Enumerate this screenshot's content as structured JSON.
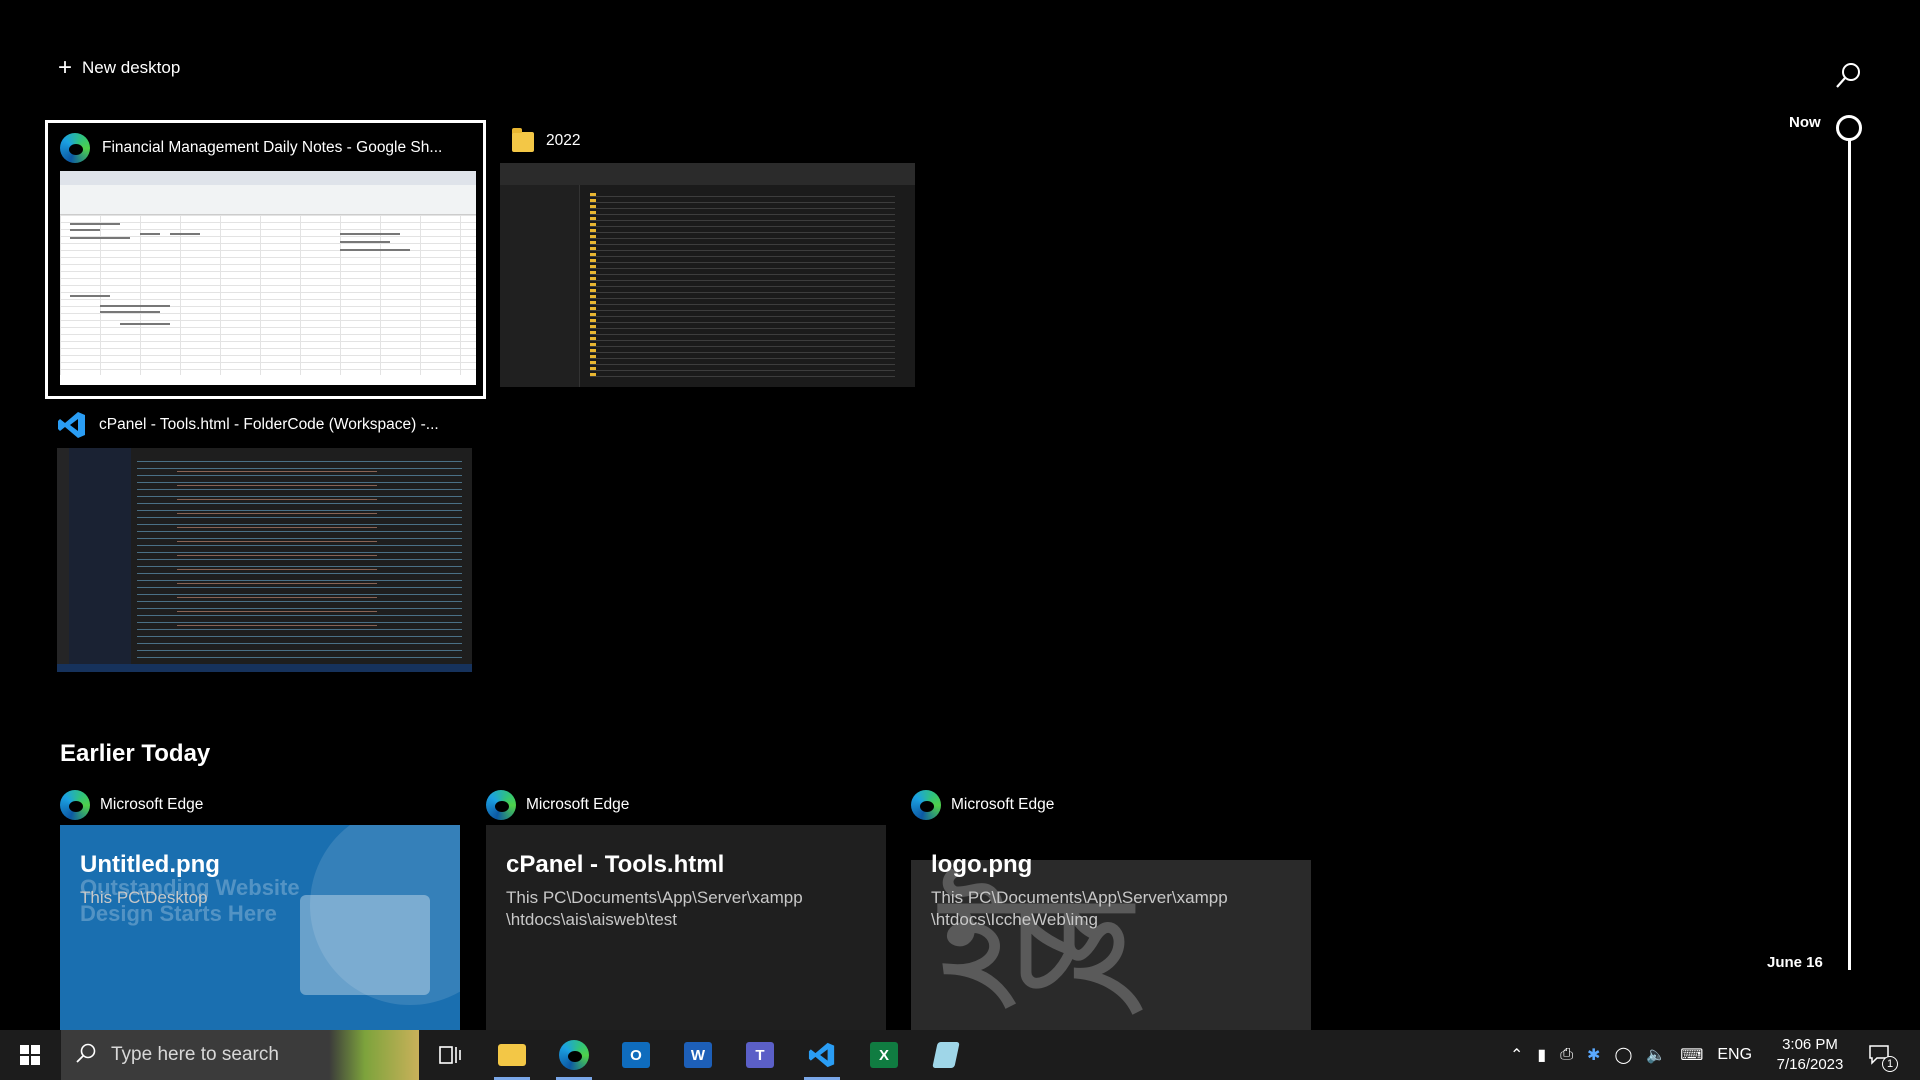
{
  "top": {
    "new_desktop_label": "New desktop"
  },
  "timeline": {
    "now_label": "Now",
    "end_label": "June 16"
  },
  "windows": [
    {
      "title": "Financial Management Daily Notes - Google Sh...",
      "icon": "edge-icon",
      "selected": true
    },
    {
      "title": "2022",
      "icon": "folder-icon",
      "selected": false
    },
    {
      "title": "cPanel - Tools.html - FolderCode (Workspace) -...",
      "icon": "vscode-icon",
      "selected": false
    }
  ],
  "earlier": {
    "section_title": "Earlier Today",
    "cards": [
      {
        "app": "Microsoft Edge",
        "title": "Untitled.png",
        "path": "This PC\\Desktop",
        "overlay_text": "Outstanding Website Design Starts Here"
      },
      {
        "app": "Microsoft Edge",
        "title": "cPanel - Tools.html",
        "path": "This PC\\Documents\\App\\Server\\xampp \\htdocs\\ais\\aisweb\\test"
      },
      {
        "app": "Microsoft Edge",
        "title": "logo.png",
        "path": "This PC\\Documents\\App\\Server\\xampp \\htdocs\\IccheWeb\\img"
      }
    ]
  },
  "taskbar": {
    "search_placeholder": "Type here to search",
    "apps": [
      "file-explorer-icon",
      "edge-icon",
      "outlook-icon",
      "word-icon",
      "teams-icon",
      "vscode-icon",
      "excel-icon",
      "notepad-icon"
    ],
    "language": "ENG",
    "time": "3:06 PM",
    "date": "7/16/2023",
    "notification_count": "1"
  },
  "colors": {
    "background": "#000000",
    "taskbar": "#1c1c1c",
    "accent": "#7aa7e8"
  }
}
